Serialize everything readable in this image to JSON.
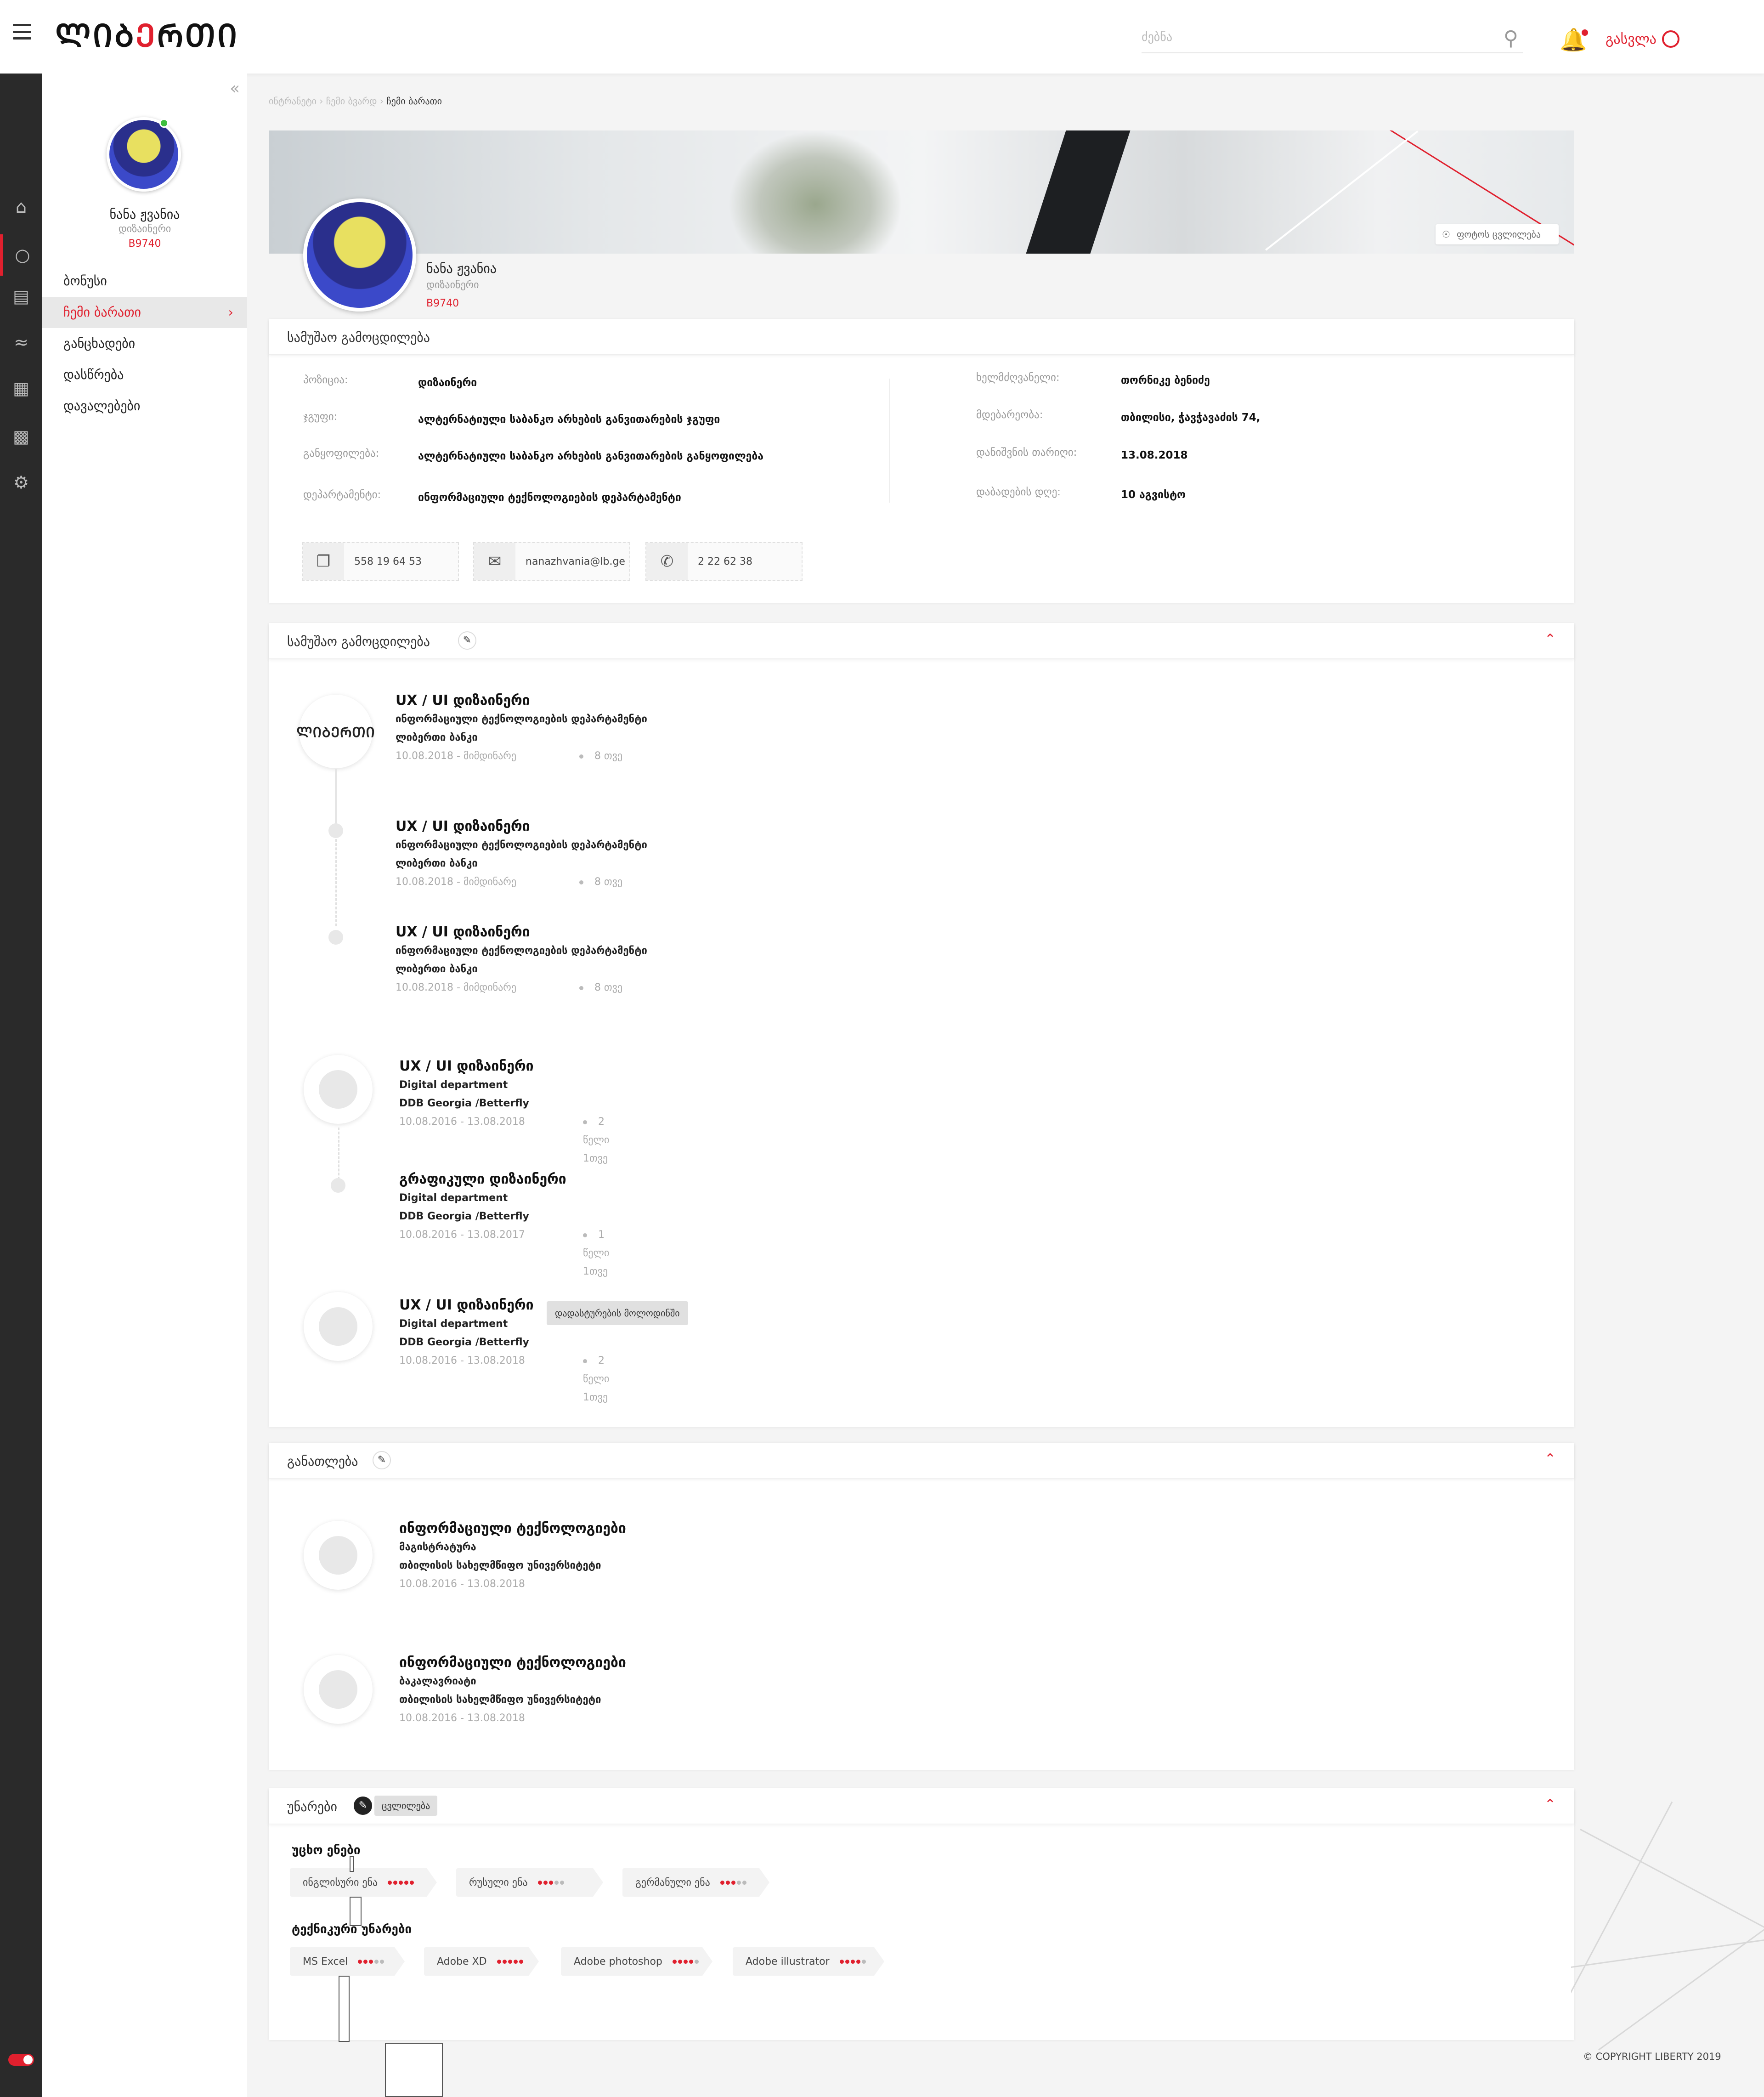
{
  "header": {
    "logo_main": "ᲚᲘᲑ",
    "logo_accent": "Ე",
    "logo_rest": "ᲠᲗᲘ",
    "search_placeholder": "ძებნა",
    "logout_label": "გასვლა"
  },
  "colors": {
    "accent": "#e0202e",
    "sidebar_dark": "#2a2a2a"
  },
  "iconbar": [
    "home-icon",
    "headset-icon",
    "news-icon",
    "wave-icon",
    "document-icon",
    "grid-icon",
    "settings-icon"
  ],
  "sidebar": {
    "name": "ნანა ჟვანია",
    "role": "დიზაინერი",
    "id": "B9740",
    "items": [
      {
        "label": "ბონუსი"
      },
      {
        "label": "ჩემი ბარათი"
      },
      {
        "label": "განცხადები"
      },
      {
        "label": "დასწრება"
      },
      {
        "label": "დავალებები"
      }
    ]
  },
  "breadcrumb": {
    "path": "ინტრანეტი › ჩემი ბვარდ ›",
    "current": "ჩემი ბარათი"
  },
  "profile": {
    "name": "ნანა ჟვანია",
    "role": "დიზაინერი",
    "id": "B9740",
    "photo_change_label": "ფოტოს ცვლილება"
  },
  "info_card": {
    "title": "სამუშაო გამოცდილება",
    "left": [
      {
        "k": "პოზიცია:",
        "v": "დიზაინერი"
      },
      {
        "k": "ჯგუფი:",
        "v": "ალტერნატიული საბანკო არხების განვითარების ჯგუფი"
      },
      {
        "k": "განყოფილება:",
        "v": "ალტერნატიული საბანკო არხების განვითარების განყოფილება"
      },
      {
        "k": "დეპარტამენტი:",
        "v": "ინფორმაციული ტექნოლოგიების დეპარტამენტი"
      }
    ],
    "right": [
      {
        "k": "ხელმძღვანელი:",
        "v": "თორნიკე ბენიძე"
      },
      {
        "k": "მდებარეობა:",
        "v": "თბილისი, ჭავჭავაძის 74,"
      },
      {
        "k": "დანიშვნის თარიღი:",
        "v": "13.08.2018"
      },
      {
        "k": "დაბადების დღე:",
        "v": "10 აგვისტო"
      }
    ],
    "contacts": [
      {
        "icon": "copy-icon",
        "text": "558 19 64 53"
      },
      {
        "icon": "mail-icon",
        "text": "nanazhvania@lb.ge"
      },
      {
        "icon": "phone-icon",
        "text": "2 22 62 38"
      }
    ]
  },
  "experience": {
    "title": "სამუშაო გამოცდილება",
    "logo_text": "ᲚᲘᲑᲔᲠᲗᲘ",
    "jobs": [
      {
        "title": "UX / UI დიზაინერი",
        "dept": "ინფორმაციული ტექნოლოგიების დეპარტამენტი",
        "org": "ლიბერთი ბანკი",
        "dates": "10.08.2018 - მიმდინარე",
        "duration": "8 თვე"
      },
      {
        "title": "UX / UI დიზაინერი",
        "dept": "ინფორმაციული ტექნოლოგიების დეპარტამენტი",
        "org": "ლიბერთი ბანკი",
        "dates": "10.08.2018 - მიმდინარე",
        "duration": "8 თვე"
      },
      {
        "title": "UX / UI დიზაინერი",
        "dept": "ინფორმაციული ტექნოლოგიების დეპარტამენტი",
        "org": "ლიბერთი ბანკი",
        "dates": "10.08.2018 - მიმდინარე",
        "duration": "8 თვე"
      },
      {
        "title": "UX / UI დიზაინერი",
        "dept": "Digital department",
        "org": "DDB Georgia /Betterfly",
        "dates": "10.08.2016 - 13.08.2018",
        "duration": "2 წელი 1თვე"
      },
      {
        "title": "გრაფიკული დიზაინერი",
        "dept": "Digital department",
        "org": "DDB Georgia /Betterfly",
        "dates": "10.08.2016 - 13.08.2017",
        "duration": "1 წელი 1თვე"
      },
      {
        "title": "UX / UI დიზაინერი",
        "dept": "Digital department",
        "org": "DDB Georgia /Betterfly",
        "dates": "10.08.2016 - 13.08.2018",
        "duration": "2 წელი 1თვე"
      }
    ],
    "pending_label": "დადასტურების მოლოდინში"
  },
  "education": {
    "title": "განათლება",
    "items": [
      {
        "title": "ინფორმაციული ტექნოლოგიები",
        "degree": "მაგისტრატურა",
        "school": "თბილისის სახელმწიფო უნივერსიტეტი",
        "dates": "10.08.2016 - 13.08.2018"
      },
      {
        "title": "ინფორმაციული ტექნოლოგიები",
        "degree": "ბაკალავრიატი",
        "school": "თბილისის სახელმწიფო უნივერსიტეტი",
        "dates": "10.08.2016 - 13.08.2018"
      }
    ]
  },
  "skills": {
    "title": "უნარები",
    "change_label": "ცვლილება",
    "languages_title": "უცხო ენები",
    "languages": [
      {
        "name": "ინგლისური ენა",
        "level": 5
      },
      {
        "name": "რუსული ენა",
        "level": 3
      },
      {
        "name": "გერმანული ენა",
        "level": 3
      }
    ],
    "tech_title": "ტექნიკური უნარები",
    "tech": [
      {
        "name": "MS Excel",
        "level": 3
      },
      {
        "name": "Adobe XD",
        "level": 5
      },
      {
        "name": "Adobe photoshop",
        "level": 4
      },
      {
        "name": "Adobe illustrator",
        "level": 4
      }
    ]
  },
  "footer": {
    "copyright": "© COPYRIGHT LIBERTY 2019"
  }
}
